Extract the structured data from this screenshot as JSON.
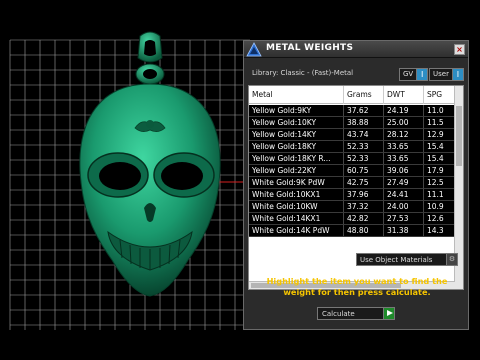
{
  "panel": {
    "title": "METAL WEIGHTS",
    "close_label": "×",
    "library_label": "Library: Classic - (Fast)-Metal",
    "toggles": [
      {
        "label": "GV",
        "button": "I"
      },
      {
        "label": "User",
        "button": "I"
      }
    ],
    "table": {
      "columns": [
        "Metal",
        "Grams",
        "DWT",
        "SPG"
      ],
      "rows": [
        [
          "Yellow Gold:9KY",
          "37.62",
          "24.19",
          "11.0"
        ],
        [
          "Yellow Gold:10KY",
          "38.88",
          "25.00",
          "11.5"
        ],
        [
          "Yellow Gold:14KY",
          "43.74",
          "28.12",
          "12.9"
        ],
        [
          "Yellow Gold:18KY",
          "52.33",
          "33.65",
          "15.4"
        ],
        [
          "Yellow Gold:18KY R...",
          "52.33",
          "33.65",
          "15.4"
        ],
        [
          "Yellow Gold:22KY",
          "60.75",
          "39.06",
          "17.9"
        ],
        [
          "White Gold:9K PdW",
          "42.75",
          "27.49",
          "12.5"
        ],
        [
          "White Gold:10KX1",
          "37.96",
          "24.41",
          "11.1"
        ],
        [
          "White Gold:10KW",
          "37.32",
          "24.00",
          "10.9"
        ],
        [
          "White Gold:14KX1",
          "42.82",
          "27.53",
          "12.6"
        ],
        [
          "White Gold:14K PdW",
          "48.80",
          "31.38",
          "14.3"
        ]
      ]
    },
    "use_materials_label": "Use Object Materials",
    "instruction": "Highlight the item you want to find the weight for then press calculate.",
    "calculate_label": "Calculate"
  },
  "colors": {
    "accent_yellow": "#f5c400",
    "model_green": "#1e9e73",
    "grid_line": "#bdbdbd",
    "axis_red": "#d42020",
    "toggle_blue": "#2d8ec4",
    "calc_green": "#1f8a2b"
  },
  "icons": {
    "logo": "app-logo-icon",
    "close": "close-icon",
    "toggle": "toggle-icon",
    "dropdown": "dropdown-icon",
    "play": "play-icon"
  }
}
